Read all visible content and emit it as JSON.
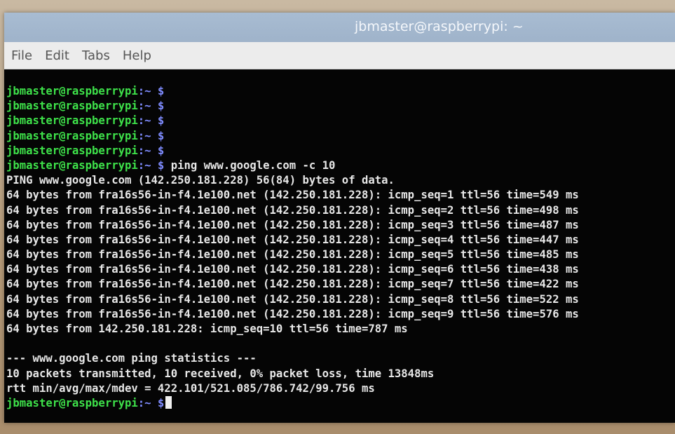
{
  "window": {
    "title": "jbmaster@raspberrypi: ~"
  },
  "menu": [
    "File",
    "Edit",
    "Tabs",
    "Help"
  ],
  "prompt": {
    "user": "jbmaster@raspberrypi",
    "path": ":~ $"
  },
  "empty_prompt_count": 5,
  "command": " ping www.google.com -c 10",
  "output": [
    "PING www.google.com (142.250.181.228) 56(84) bytes of data.",
    "64 bytes from fra16s56-in-f4.1e100.net (142.250.181.228): icmp_seq=1 ttl=56 time=549 ms",
    "64 bytes from fra16s56-in-f4.1e100.net (142.250.181.228): icmp_seq=2 ttl=56 time=498 ms",
    "64 bytes from fra16s56-in-f4.1e100.net (142.250.181.228): icmp_seq=3 ttl=56 time=487 ms",
    "64 bytes from fra16s56-in-f4.1e100.net (142.250.181.228): icmp_seq=4 ttl=56 time=447 ms",
    "64 bytes from fra16s56-in-f4.1e100.net (142.250.181.228): icmp_seq=5 ttl=56 time=485 ms",
    "64 bytes from fra16s56-in-f4.1e100.net (142.250.181.228): icmp_seq=6 ttl=56 time=438 ms",
    "64 bytes from fra16s56-in-f4.1e100.net (142.250.181.228): icmp_seq=7 ttl=56 time=422 ms",
    "64 bytes from fra16s56-in-f4.1e100.net (142.250.181.228): icmp_seq=8 ttl=56 time=522 ms",
    "64 bytes from fra16s56-in-f4.1e100.net (142.250.181.228): icmp_seq=9 ttl=56 time=576 ms",
    "64 bytes from 142.250.181.228: icmp_seq=10 ttl=56 time=787 ms",
    "",
    "--- www.google.com ping statistics ---",
    "10 packets transmitted, 10 received, 0% packet loss, time 13848ms",
    "rtt min/avg/max/mdev = 422.101/521.085/786.742/99.756 ms"
  ],
  "colors": {
    "user": "#3ee24a",
    "path": "#7f8cff",
    "text": "#e8e8e8",
    "background": "#050505"
  }
}
